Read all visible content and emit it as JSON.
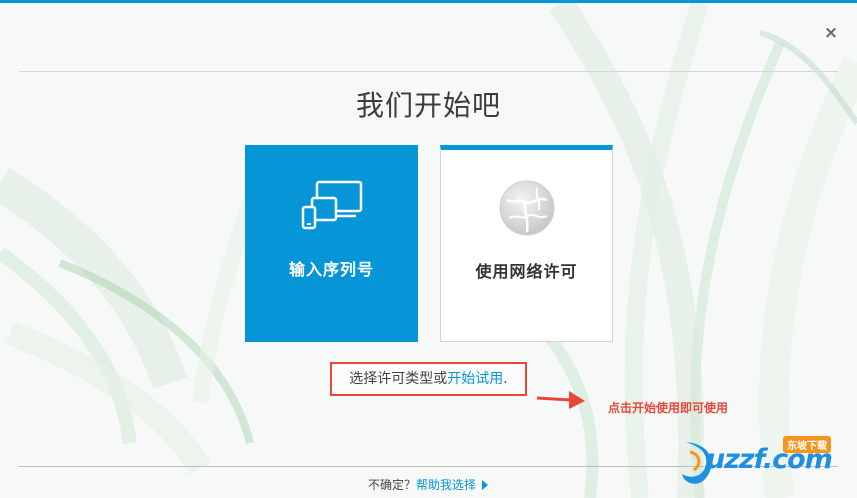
{
  "window": {
    "close_label": "×"
  },
  "title": "我们开始吧",
  "cards": [
    {
      "label": "输入序列号",
      "icon": "devices-icon"
    },
    {
      "label": "使用网络许可",
      "icon": "network-globe-icon"
    }
  ],
  "prompt": {
    "text": "选择许可类型或",
    "link": "开始试用",
    "suffix": "."
  },
  "annotation": "点击开始使用即可使用",
  "footer": {
    "text": "不确定？",
    "link": "帮助我选择"
  },
  "watermark": {
    "text": "uzzf.com",
    "badge": "东坡下载"
  },
  "colors": {
    "accent": "#0696d7",
    "annotation": "#e8483c",
    "watermark": "#1f8fe2",
    "badge": "#f7941d"
  }
}
